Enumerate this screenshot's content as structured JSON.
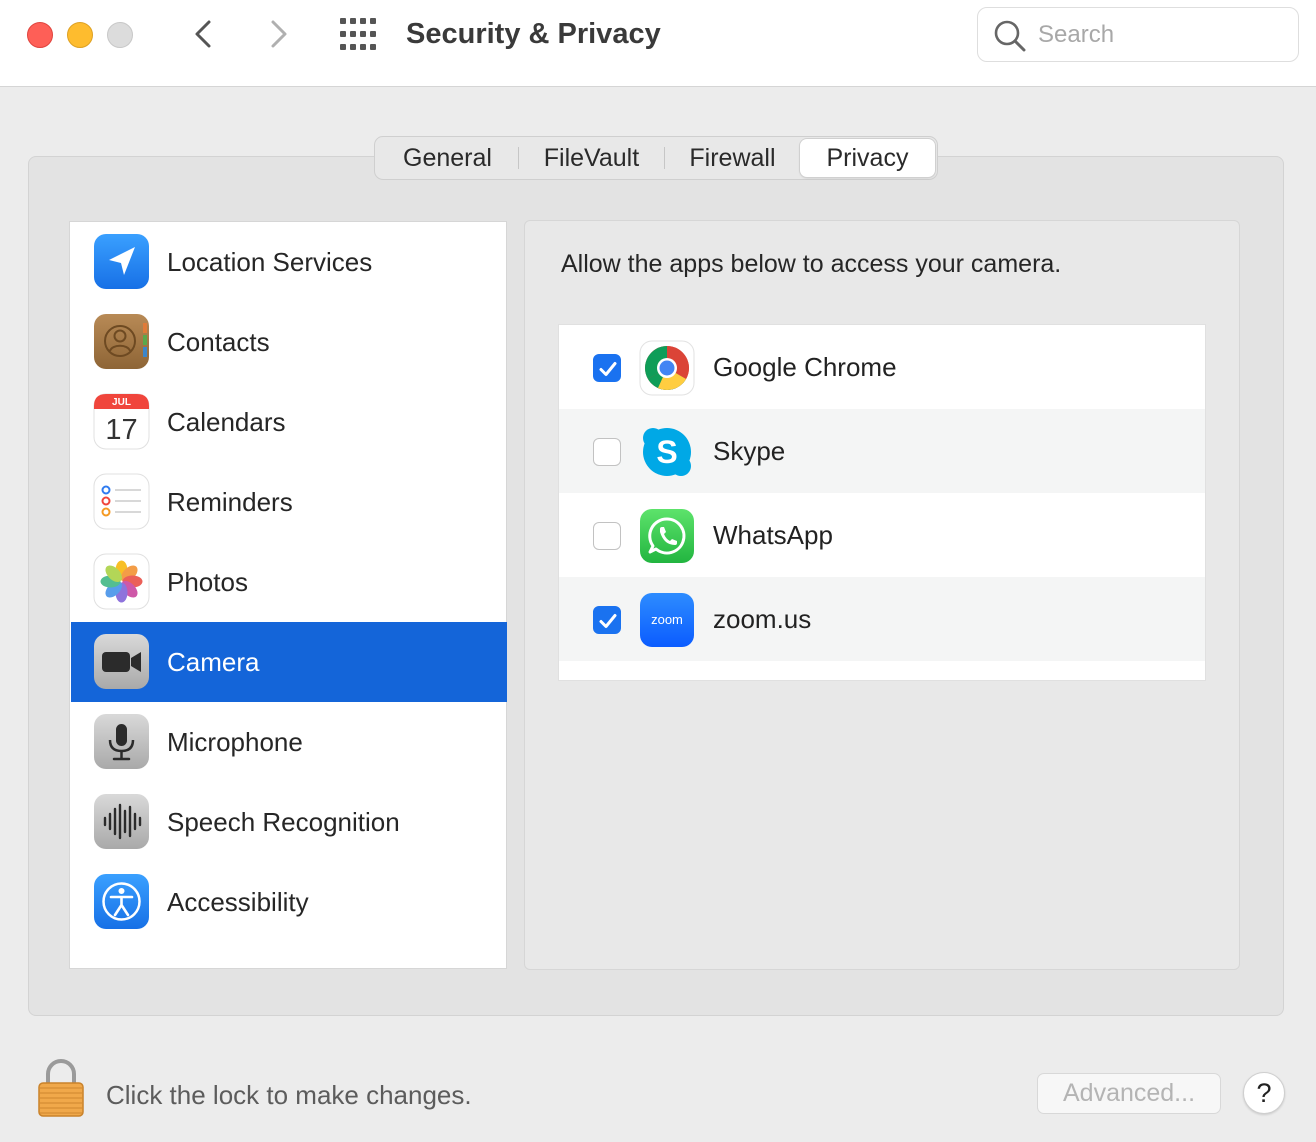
{
  "window": {
    "title": "Security & Privacy"
  },
  "search": {
    "placeholder": "Search"
  },
  "tabs": [
    {
      "label": "General"
    },
    {
      "label": "FileVault"
    },
    {
      "label": "Firewall"
    },
    {
      "label": "Privacy",
      "selected": true
    }
  ],
  "sidebar": {
    "items": [
      {
        "label": "Location Services",
        "icon": "location-icon"
      },
      {
        "label": "Contacts",
        "icon": "contacts-icon"
      },
      {
        "label": "Calendars",
        "icon": "calendar-icon",
        "month": "JUL",
        "day": "17"
      },
      {
        "label": "Reminders",
        "icon": "reminders-icon"
      },
      {
        "label": "Photos",
        "icon": "photos-icon"
      },
      {
        "label": "Camera",
        "icon": "camera-icon",
        "selected": true
      },
      {
        "label": "Microphone",
        "icon": "microphone-icon"
      },
      {
        "label": "Speech Recognition",
        "icon": "speech-recognition-icon"
      },
      {
        "label": "Accessibility",
        "icon": "accessibility-icon"
      }
    ]
  },
  "content": {
    "description": "Allow the apps below to access your camera.",
    "apps": [
      {
        "name": "Google Chrome",
        "checked": true,
        "icon": "chrome-icon"
      },
      {
        "name": "Skype",
        "checked": false,
        "icon": "skype-icon",
        "logo_text": "S"
      },
      {
        "name": "WhatsApp",
        "checked": false,
        "icon": "whatsapp-icon"
      },
      {
        "name": "zoom.us",
        "checked": true,
        "icon": "zoom-icon",
        "logo_text": "zoom"
      }
    ]
  },
  "footer": {
    "lock_text": "Click the lock to make changes.",
    "advanced_label": "Advanced...",
    "help_label": "?"
  },
  "colors": {
    "selection": "#1465d9",
    "checkbox_on": "#1a72f0"
  }
}
